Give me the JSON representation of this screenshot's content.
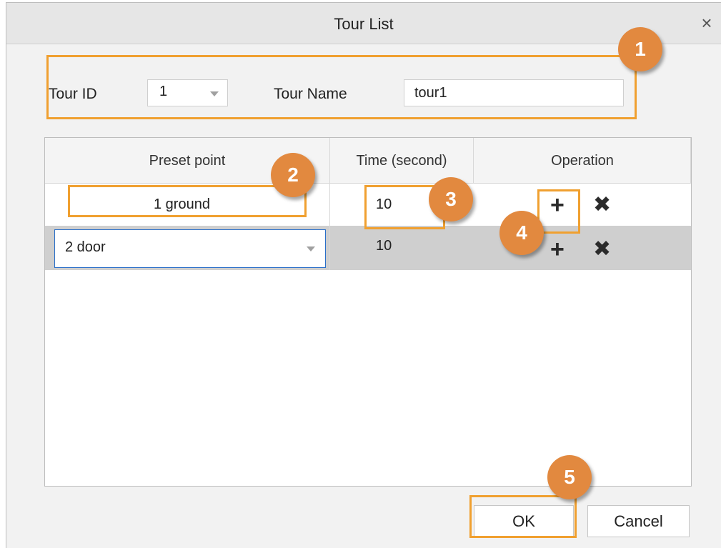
{
  "dialog": {
    "title": "Tour List",
    "close_icon": "×"
  },
  "form": {
    "tour_id_label": "Tour ID",
    "tour_id_value": "1",
    "tour_name_label": "Tour Name",
    "tour_name_value": "tour1"
  },
  "table": {
    "headers": [
      "Preset point",
      "Time (second)",
      "Operation"
    ],
    "rows": [
      {
        "preset": "1  ground",
        "time": "10"
      },
      {
        "preset": "2  door",
        "time": "10"
      }
    ],
    "add_icon": "+",
    "delete_icon": "✖"
  },
  "buttons": {
    "ok": "OK",
    "cancel": "Cancel"
  },
  "callouts": [
    "1",
    "2",
    "3",
    "4",
    "5"
  ],
  "colors": {
    "highlight": "#f0a030",
    "badge": "#e2893f",
    "selected_row": "#cfcfcf",
    "focus_border": "#2a6fc9"
  }
}
